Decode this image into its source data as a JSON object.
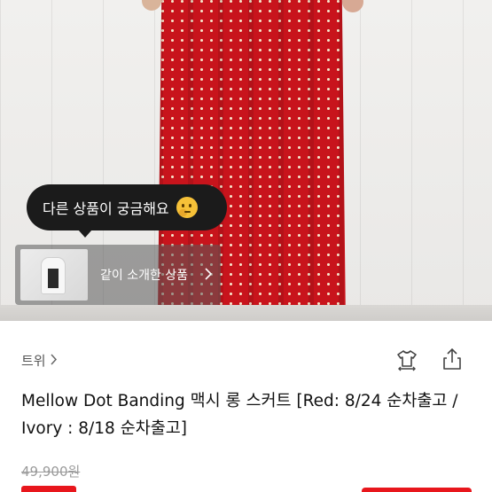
{
  "photo": {
    "tooltip": {
      "text": "다른 상품이 궁금해요",
      "emoji_icon": "thinking-face-icon"
    },
    "related": {
      "label": "같이 소개한 상품",
      "arrow_icon": "chevron-right-icon"
    }
  },
  "seller": {
    "name": "트위",
    "chevron_icon": "chevron-right-icon"
  },
  "actions": {
    "closet_icon": "closet-hanger-icon",
    "share_icon": "share-icon"
  },
  "product": {
    "title": "Mellow Dot Banding 맥시 롱 스커트 [Red: 8/24 순차출고 / Ivory : 8/18 순차출고]",
    "original_price": "49,900원"
  },
  "colors": {
    "accent": "#e8161c",
    "tooltip_bg": "#1b1b1b",
    "muted_text": "#9b9b9b"
  }
}
